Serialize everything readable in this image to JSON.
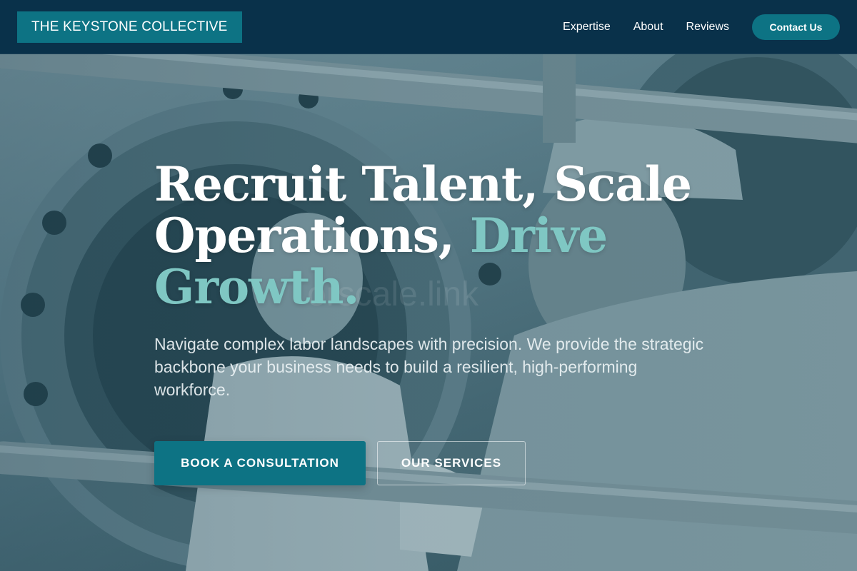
{
  "header": {
    "brand": "THE KEYSTONE COLLECTIVE",
    "nav": [
      {
        "label": "Expertise"
      },
      {
        "label": "About"
      },
      {
        "label": "Reviews"
      }
    ],
    "contact_label": "Contact Us"
  },
  "hero": {
    "headline_part1": "Recruit Talent, Scale Operations, ",
    "headline_accent": "Drive Growth.",
    "ghost_text": "orscale.link",
    "subtext": "Navigate complex labor landscapes with precision. We provide the strategic backbone your business needs to build a resilient, high-performing workforce.",
    "primary_cta": "BOOK A CONSULTATION",
    "secondary_cta": "OUR SERVICES"
  },
  "background": {
    "image": "industrial-workers-photo"
  },
  "colors": {
    "header_bg": "#09314a",
    "accent": "#0d7384",
    "headline_accent": "#7fc7c3"
  }
}
